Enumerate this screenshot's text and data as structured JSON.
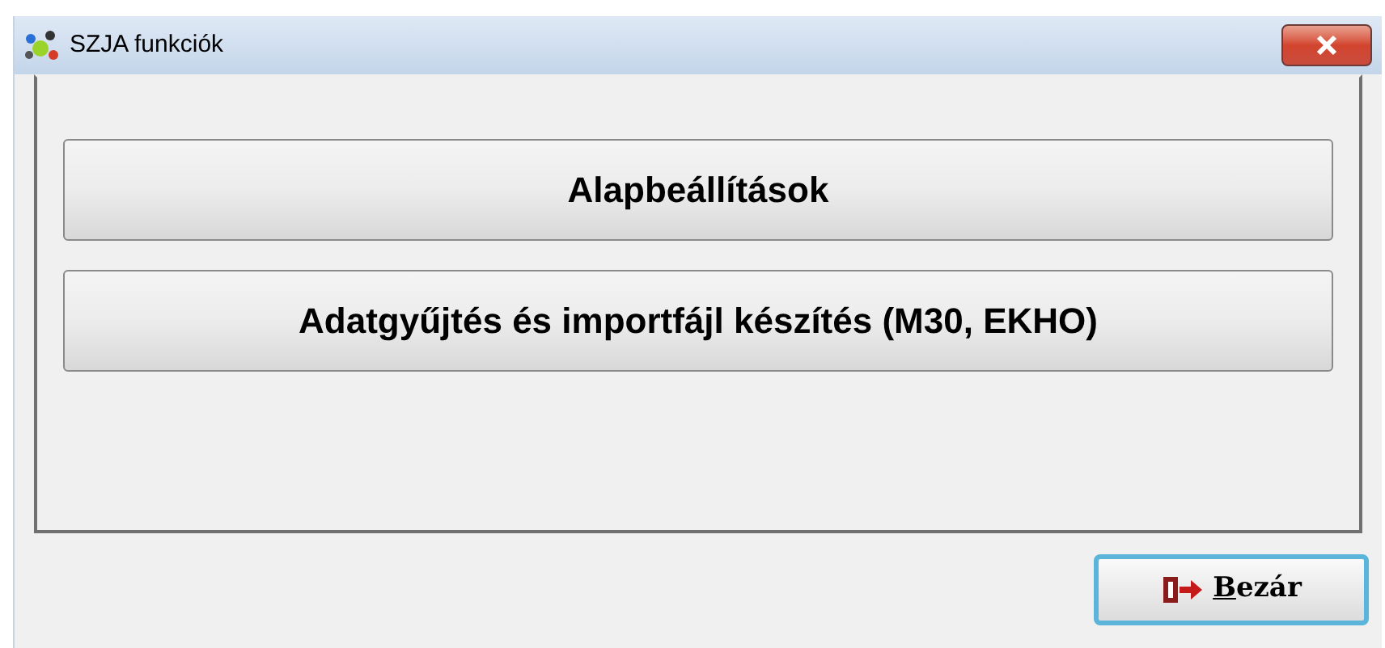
{
  "window": {
    "title": "SZJA funkciók"
  },
  "buttons": [
    {
      "label": "Alapbeállítások"
    },
    {
      "label": "Adatgyűjtés és importfájl készítés (M30, EKHO)"
    }
  ],
  "close_button": {
    "label": "Bezár",
    "accelerator_underlined": true,
    "focused": true
  }
}
